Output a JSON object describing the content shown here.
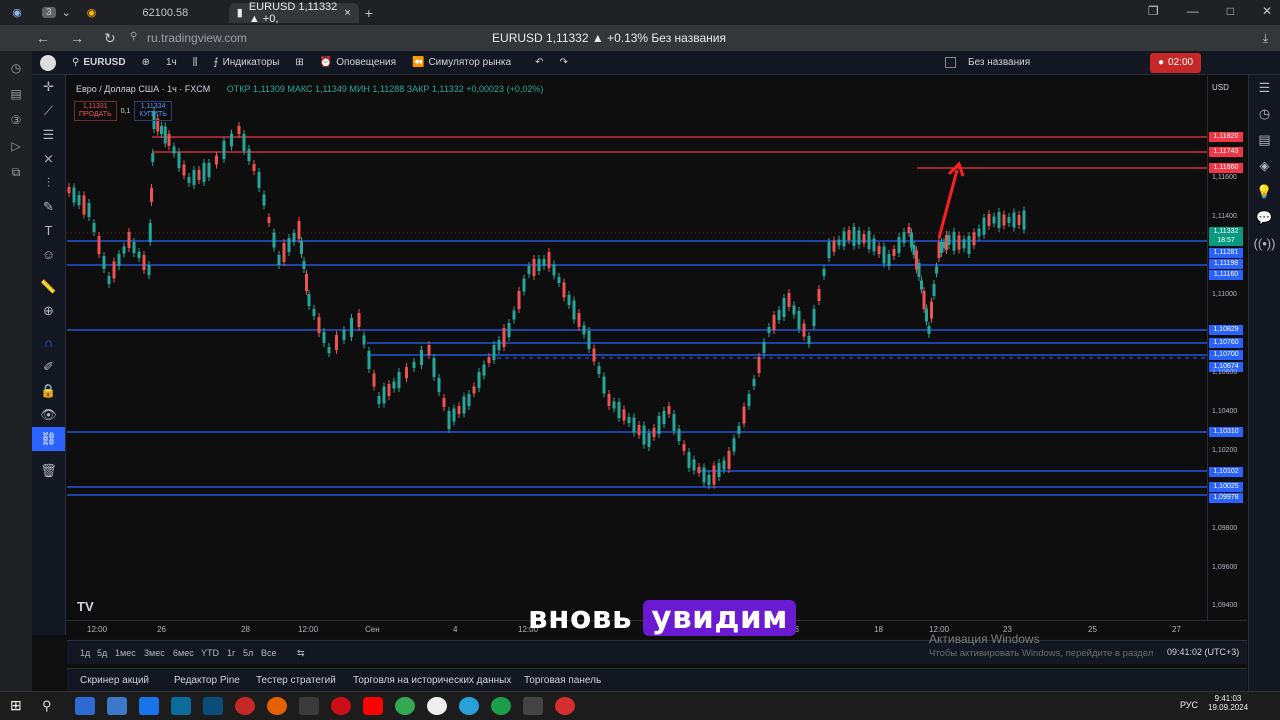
{
  "browser": {
    "tabs": [
      {
        "label": "",
        "badge": "3"
      },
      {
        "label": "62100.58"
      },
      {
        "label": "EURUSD 1,11332 ▲ +0,",
        "active": true
      }
    ],
    "url": "ru.tradingview.com",
    "page_title": "EURUSD 1,11332 ▲ +0.13% Без названия"
  },
  "tv_top": {
    "symbol": "EURUSD",
    "interval": "1ч",
    "indicators": "Индикаторы",
    "alerts": "Оповещения",
    "replay": "Симулятор рынка",
    "layout_name": "Без названия",
    "record_time": "02:00"
  },
  "legend": {
    "title": "Евро / Доллар США · 1ч · FXCM",
    "ohlc": "ОТКР 1,11309  МАКС 1,11349  МИН 1,11288  ЗАКР 1,11332  +0,00023 (+0,02%)",
    "sell_price": "1,11331",
    "sell_label": "ПРОДАТЬ",
    "spread": "0,1",
    "buy_price": "1,11334",
    "buy_label": "КУПИТЬ"
  },
  "currency": "USD",
  "price_labels": [
    {
      "v": "1,11820",
      "c": "#f23645"
    },
    {
      "v": "1,11743",
      "c": "#f23645"
    },
    {
      "v": "1,11660",
      "c": "#f23645"
    },
    {
      "v": "1,11332",
      "c": "#089981"
    },
    {
      "v": "18:57",
      "c": "#089981"
    },
    {
      "v": "1,11281",
      "c": "#2962ff"
    },
    {
      "v": "1,11198",
      "c": "#2962ff"
    },
    {
      "v": "1,11160",
      "c": "#2962ff"
    },
    {
      "v": "1,10829",
      "c": "#2962ff"
    },
    {
      "v": "1,10760",
      "c": "#2962ff"
    },
    {
      "v": "1,10700",
      "c": "#2962ff"
    },
    {
      "v": "1,10674",
      "c": "#2962ff"
    },
    {
      "v": "1,10310",
      "c": "#2962ff"
    },
    {
      "v": "1,10102",
      "c": "#2962ff"
    },
    {
      "v": "1,10025",
      "c": "#2962ff"
    },
    {
      "v": "1,09978",
      "c": "#2962ff"
    }
  ],
  "price_ticks": [
    "1,11600",
    "1,11400",
    "1,11000",
    "1,10600",
    "1,10400",
    "1,10200",
    "1,09800",
    "1,09600",
    "1,09400"
  ],
  "time_ticks": [
    "12:00",
    "26",
    "28",
    "12:00",
    "Сен",
    "4",
    "12:00",
    "16",
    "18",
    "12:00",
    "23",
    "25",
    "27"
  ],
  "ranges": [
    "1д",
    "5д",
    "1мес",
    "3мес",
    "6мес",
    "YTD",
    "1г",
    "5л",
    "Все"
  ],
  "clock": "09:41:02 (UTC+3)",
  "bottom_tabs": [
    "Скринер акций",
    "Редактор Pine",
    "Тестер стратегий",
    "Торговля на исторических данных",
    "Торговая панель"
  ],
  "subtitle": {
    "word1": "вновь",
    "word2": "увидим"
  },
  "windows_activation": {
    "title": "Активация Windows",
    "text": "Чтобы активировать Windows, перейдите в раздел"
  },
  "taskbar": {
    "lang": "РУС",
    "time": "9:41:03",
    "date": "19.09.2024"
  }
}
